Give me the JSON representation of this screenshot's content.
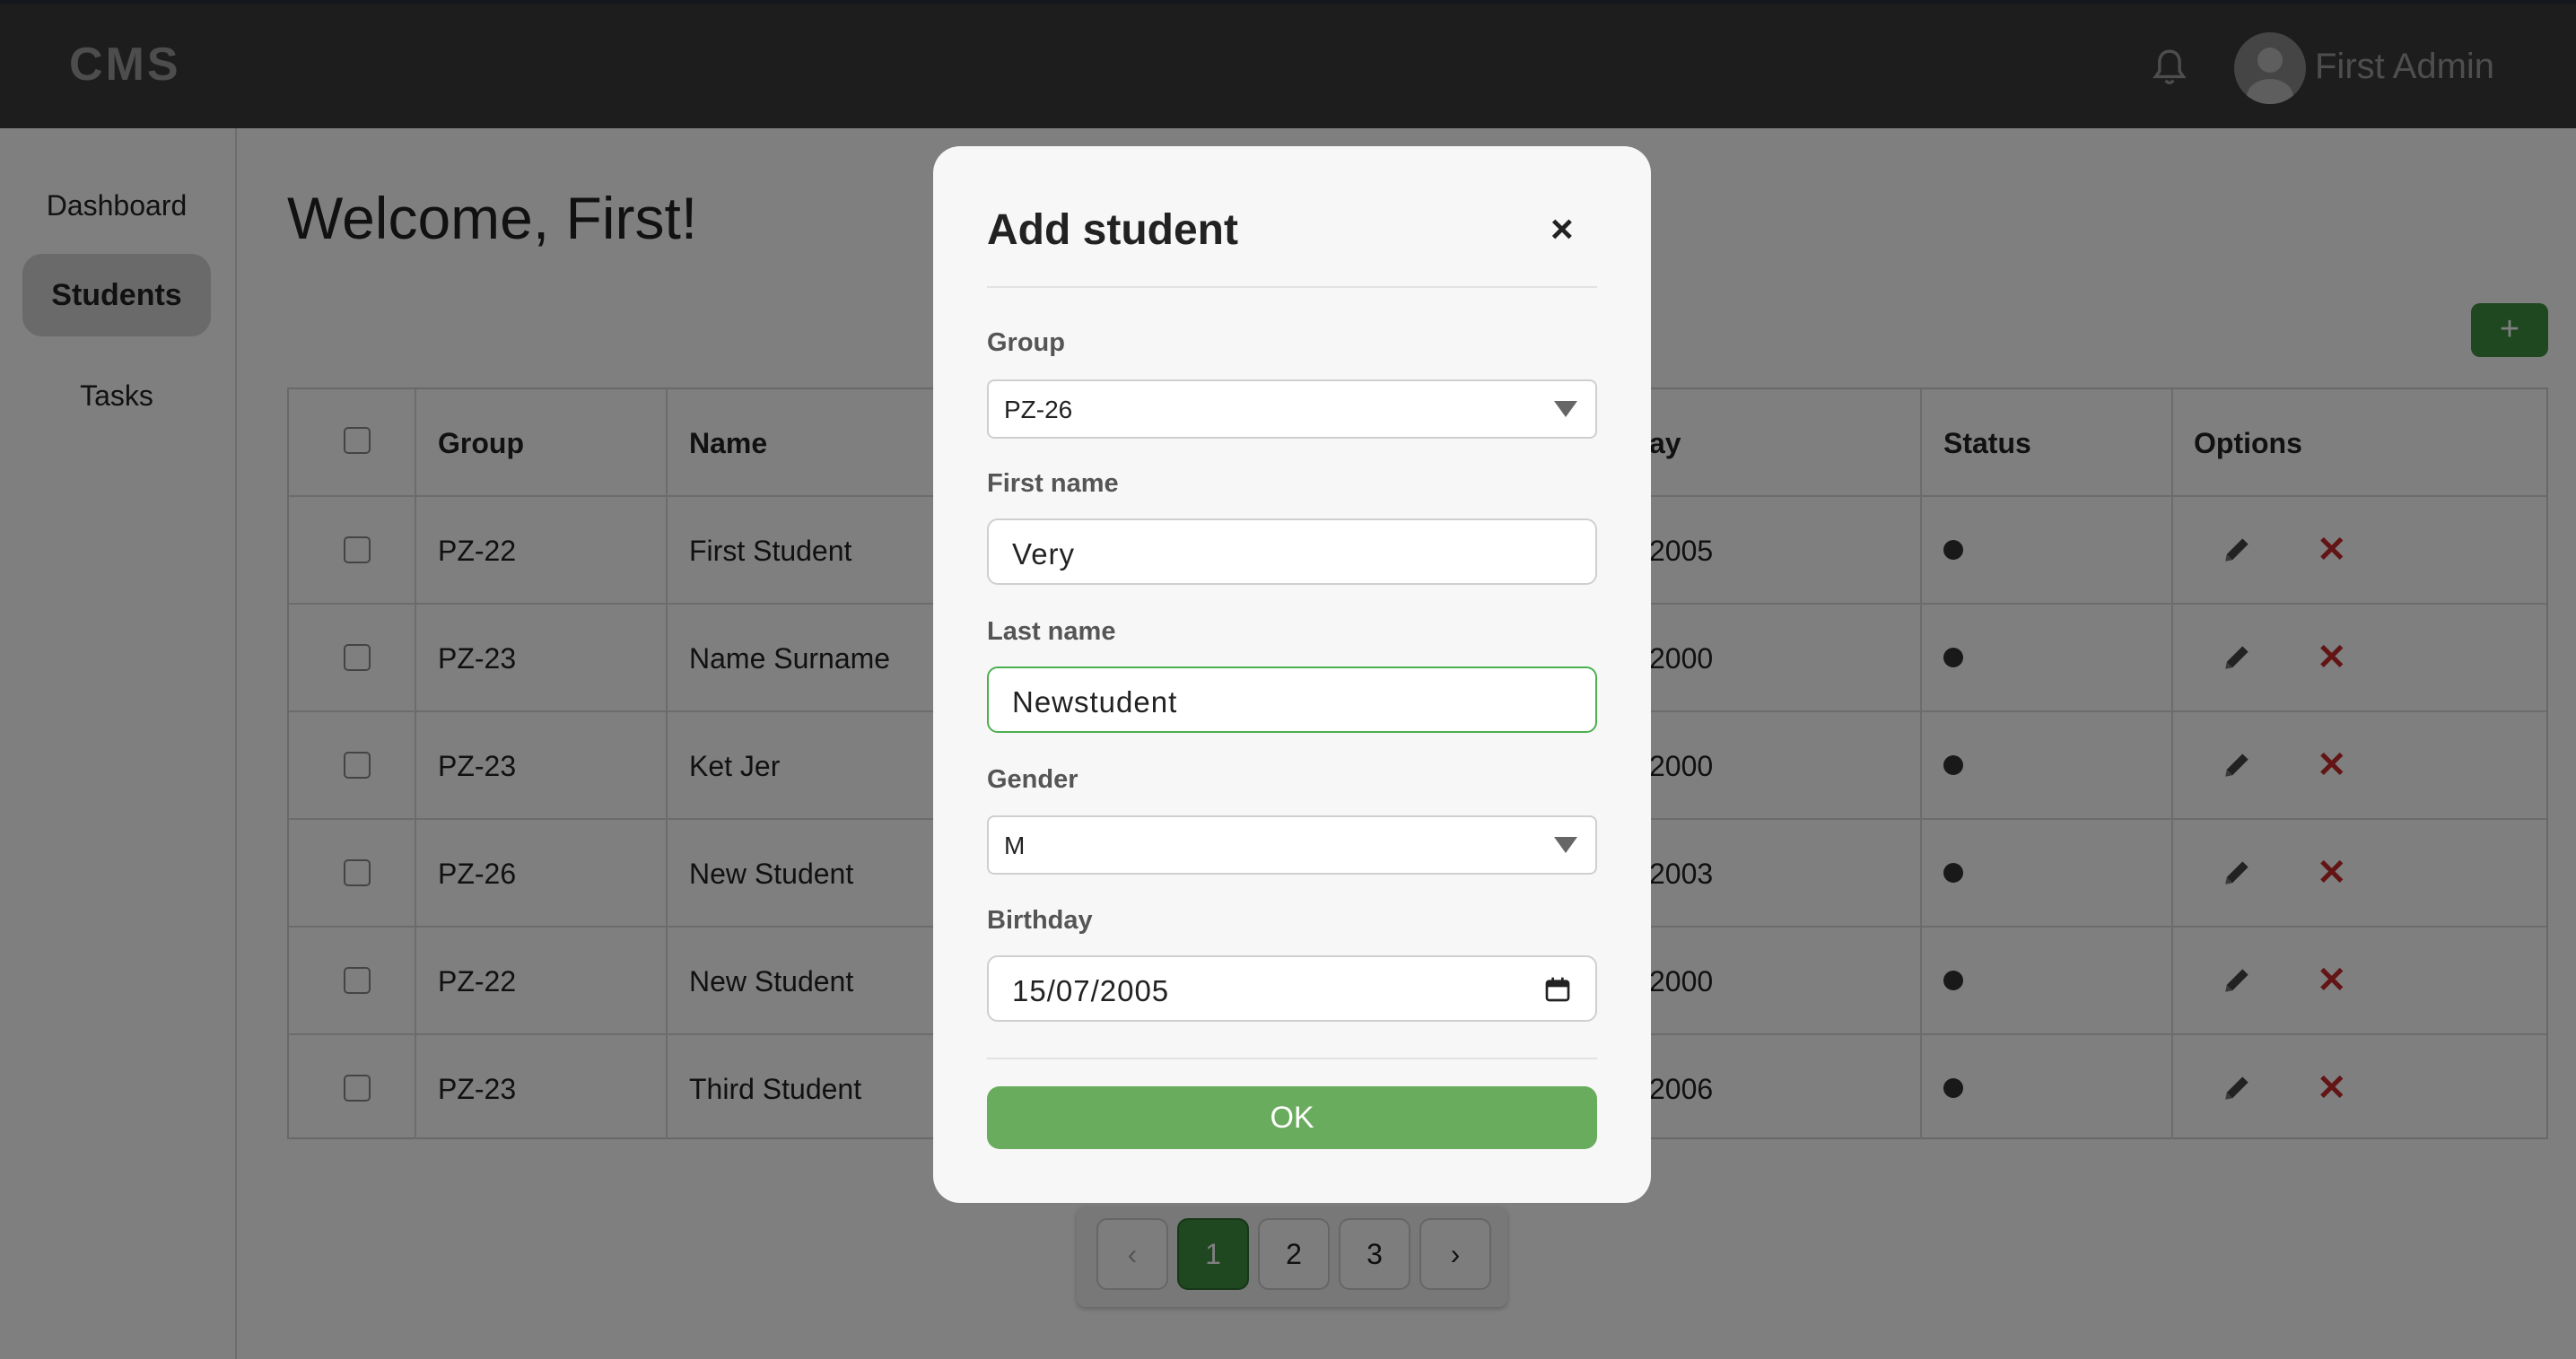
{
  "header": {
    "logo": "CMS",
    "user_name": "First Admin"
  },
  "sidebar": {
    "items": [
      {
        "label": "Dashboard"
      },
      {
        "label": "Students"
      },
      {
        "label": "Tasks"
      }
    ]
  },
  "main": {
    "welcome": "Welcome, First!",
    "add_button": "+"
  },
  "table": {
    "headers": {
      "group": "Group",
      "name": "Name",
      "birthday_partial": "ay",
      "status": "Status",
      "options": "Options"
    },
    "rows": [
      {
        "group": "PZ-22",
        "name": "First Student",
        "birthday_partial": "2005"
      },
      {
        "group": "PZ-23",
        "name": "Name Surname",
        "birthday_partial": "2000"
      },
      {
        "group": "PZ-23",
        "name": "Ket Jer",
        "birthday_partial": "2000"
      },
      {
        "group": "PZ-26",
        "name": "New Student",
        "birthday_partial": "2003"
      },
      {
        "group": "PZ-22",
        "name": "New Student",
        "birthday_partial": "2000"
      },
      {
        "group": "PZ-23",
        "name": "Third Student",
        "birthday_partial": "2006"
      }
    ],
    "delete_glyph": "✕"
  },
  "pagination": {
    "prev": "‹",
    "pages": [
      "1",
      "2",
      "3"
    ],
    "next": "›",
    "current": "1"
  },
  "modal": {
    "title": "Add student",
    "close": "×",
    "group_label": "Group",
    "group_value": "PZ-26",
    "first_name_label": "First name",
    "first_name_value": "Very",
    "last_name_label": "Last name",
    "last_name_value": "Newstudent",
    "gender_label": "Gender",
    "gender_value": "M",
    "birthday_label": "Birthday",
    "birthday_value": "15/07/2005",
    "ok_label": "OK"
  },
  "colors": {
    "accent": "#3e8e41",
    "ok_button": "#6aac5e",
    "delete": "#c62828",
    "header_bg": "#3a3a3a"
  }
}
